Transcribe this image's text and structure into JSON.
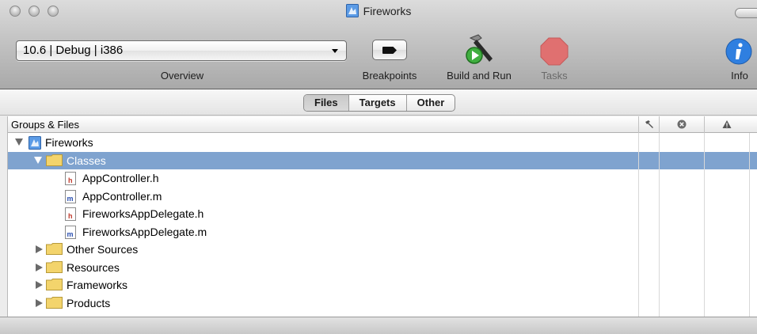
{
  "window": {
    "title": "Fireworks"
  },
  "toolbar": {
    "overview_value": "10.6 | Debug | i386",
    "overview_label": "Overview",
    "breakpoints_label": "Breakpoints",
    "build_and_run_label": "Build and Run",
    "tasks_label": "Tasks",
    "info_label": "Info"
  },
  "scope_tabs": [
    {
      "label": "Files",
      "selected": true
    },
    {
      "label": "Targets",
      "selected": false
    },
    {
      "label": "Other",
      "selected": false
    }
  ],
  "outline": {
    "header_title": "Groups & Files",
    "column_icons": [
      "build-hammer-icon",
      "error-x-icon",
      "warning-triangle-icon"
    ],
    "rows": [
      {
        "label": "Fireworks",
        "icon": "project-icon",
        "expanded": true
      },
      {
        "label": "Classes",
        "icon": "folder-icon",
        "expanded": true,
        "selected": true
      },
      {
        "label": "AppController.h",
        "icon": "header-file-icon"
      },
      {
        "label": "AppController.m",
        "icon": "source-file-icon"
      },
      {
        "label": "FireworksAppDelegate.h",
        "icon": "header-file-icon"
      },
      {
        "label": "FireworksAppDelegate.m",
        "icon": "source-file-icon"
      },
      {
        "label": "Other Sources",
        "icon": "folder-icon",
        "expanded": false
      },
      {
        "label": "Resources",
        "icon": "folder-icon",
        "expanded": false
      },
      {
        "label": "Frameworks",
        "icon": "folder-icon",
        "expanded": false
      },
      {
        "label": "Products",
        "icon": "folder-icon",
        "expanded": false
      }
    ]
  },
  "colors": {
    "selection": "#7fa3cf",
    "tasks_stop": "#e07070",
    "info_blue": "#2f7fe0",
    "folder": "#f3d46c"
  }
}
